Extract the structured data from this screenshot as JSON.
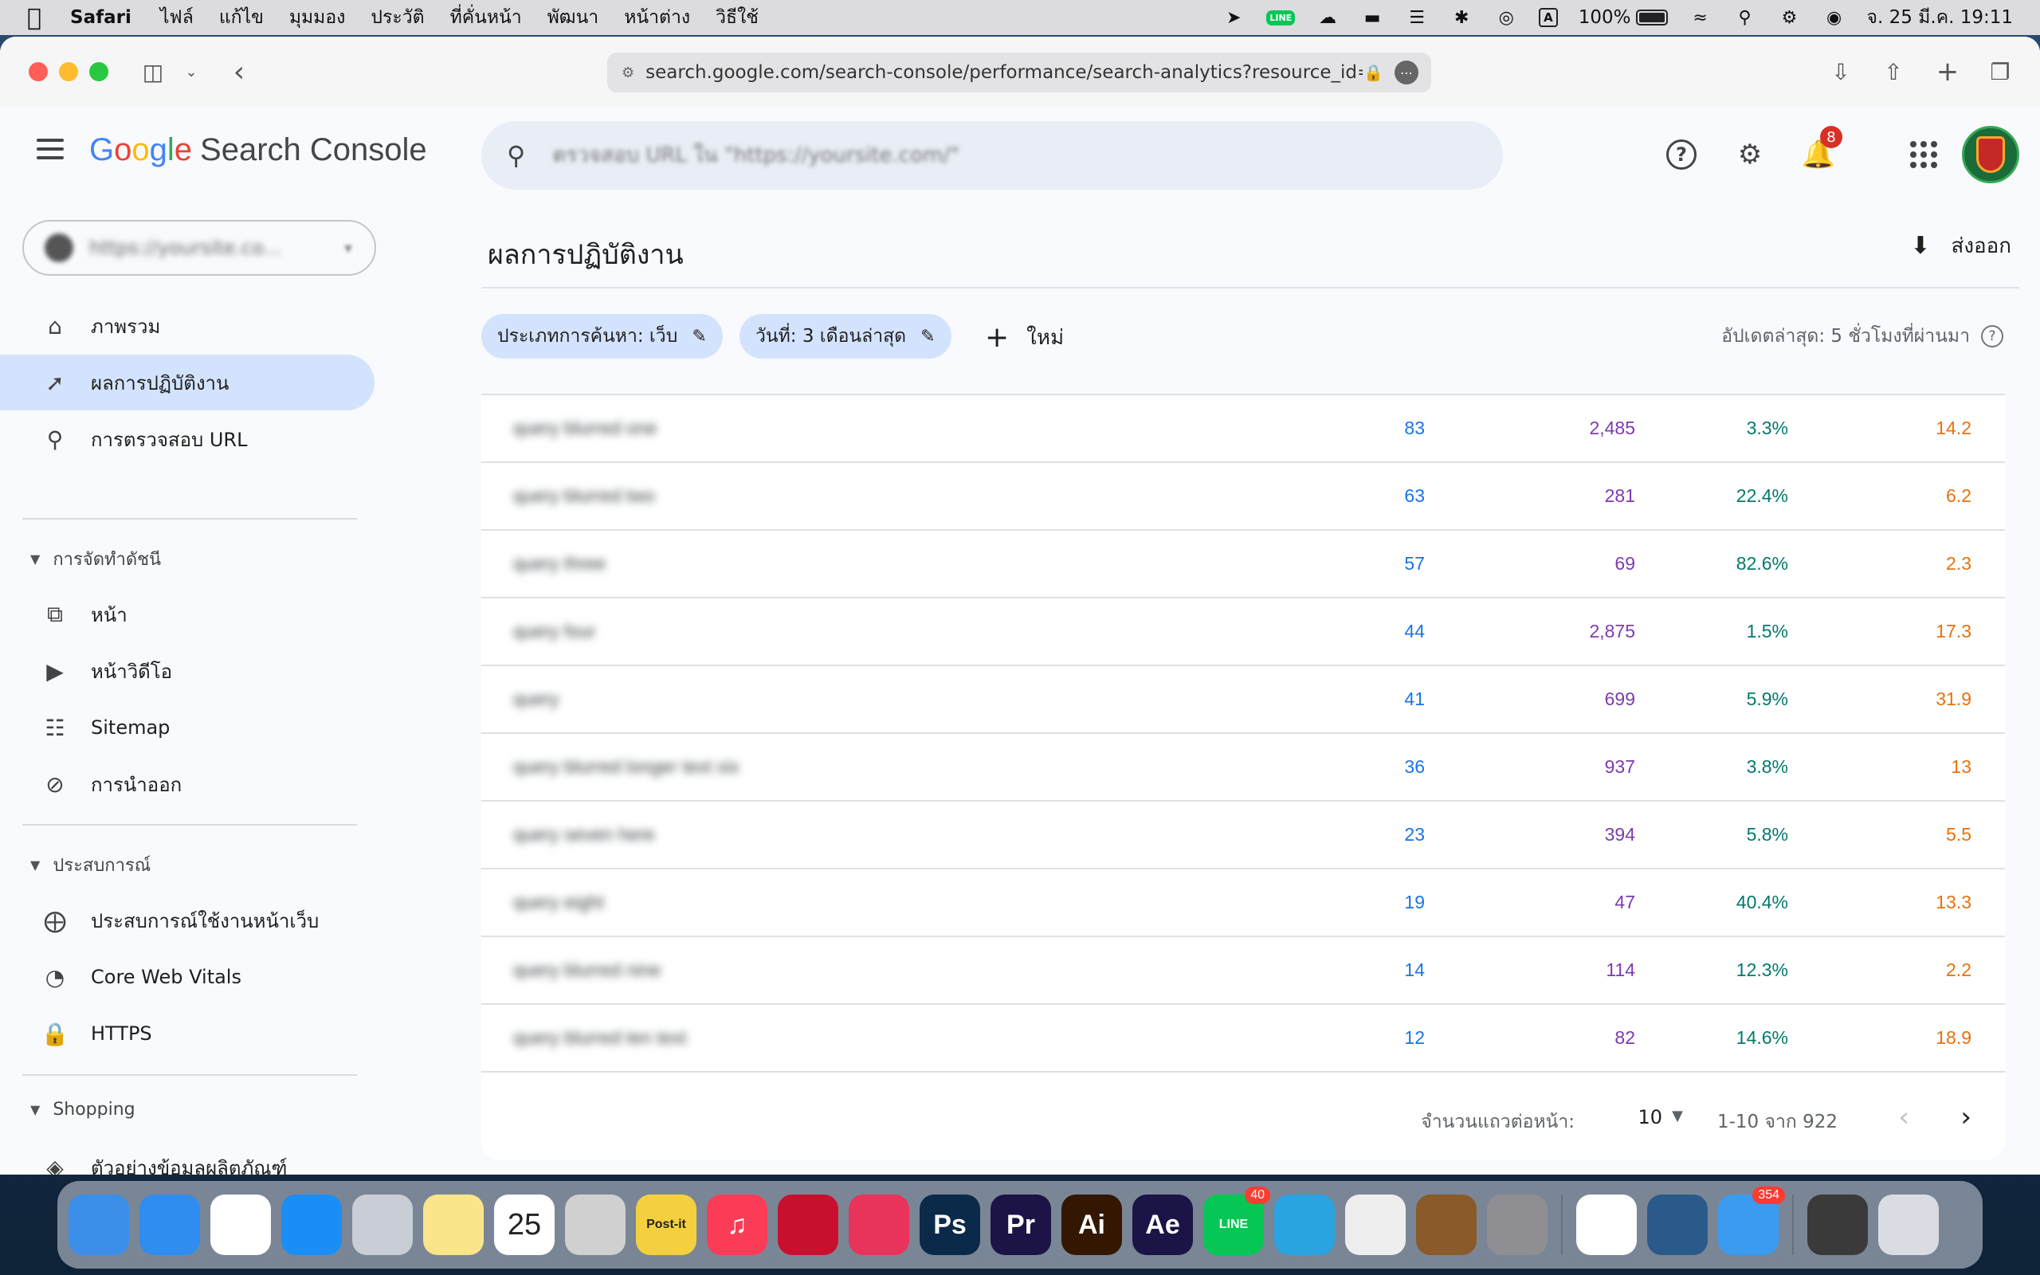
{
  "menubar": {
    "app_name": "Safari",
    "menus": [
      "ไฟล์",
      "แก้ไข",
      "มุมมอง",
      "ประวัติ",
      "ที่คั่นหน้า",
      "พัฒนา",
      "หน้าต่าง",
      "วิธีใช้"
    ],
    "battery": "100%",
    "input_source": "A",
    "clock": "จ. 25 มี.ค. 19:11"
  },
  "browser": {
    "url": "search.google.com/search-console/performance/search-analytics?resource_id=ht"
  },
  "header": {
    "logo_g": [
      "G",
      "o",
      "o",
      "g",
      "l",
      "e"
    ],
    "product": "Search Console",
    "search_placeholder": "ตรวจสอบ URL ใน \"https://yoursite.com/\"",
    "notification_count": "8"
  },
  "sidebar": {
    "property": "https://yoursite.co...",
    "items": [
      {
        "label": "ภาพรวม",
        "icon": "home-icon"
      },
      {
        "label": "ผลการปฏิบัติงาน",
        "icon": "trending-up-icon"
      },
      {
        "label": "การตรวจสอบ URL",
        "icon": "search-icon"
      }
    ],
    "section_index": {
      "title": "การจัดทำดัชนี",
      "items": [
        {
          "label": "หน้า",
          "icon": "pages-icon"
        },
        {
          "label": "หน้าวิดีโอ",
          "icon": "video-pages-icon"
        },
        {
          "label": "Sitemap",
          "icon": "sitemap-icon"
        },
        {
          "label": "การนำออก",
          "icon": "removals-icon"
        }
      ]
    },
    "section_experience": {
      "title": "ประสบการณ์",
      "items": [
        {
          "label": "ประสบการณ์ใช้งานหน้าเว็บ",
          "icon": "page-experience-icon"
        },
        {
          "label": "Core Web Vitals",
          "icon": "gauge-icon"
        },
        {
          "label": "HTTPS",
          "icon": "lock-icon"
        }
      ]
    },
    "section_shopping": {
      "title": "Shopping",
      "items": [
        {
          "label": "ตัวอย่างข้อมูลผลิตภัณฑ์",
          "icon": "layers-icon"
        }
      ]
    }
  },
  "main": {
    "title": "ผลการปฏิบัติงาน",
    "export_label": "ส่งออก",
    "chip_search_type": "ประเภทการค้นหา: เว็บ",
    "chip_date": "วันที่: 3 เดือนล่าสุด",
    "new_label": "ใหม่",
    "updated": "อัปเดตล่าสุด: 5 ชั่วโมงที่ผ่านมา",
    "rows": [
      {
        "query": "query blurred one",
        "clicks": "83",
        "impressions": "2,485",
        "ctr": "3.3%",
        "position": "14.2"
      },
      {
        "query": "query blurred two",
        "clicks": "63",
        "impressions": "281",
        "ctr": "22.4%",
        "position": "6.2"
      },
      {
        "query": "query three",
        "clicks": "57",
        "impressions": "69",
        "ctr": "82.6%",
        "position": "2.3"
      },
      {
        "query": "query four",
        "clicks": "44",
        "impressions": "2,875",
        "ctr": "1.5%",
        "position": "17.3"
      },
      {
        "query": "query",
        "clicks": "41",
        "impressions": "699",
        "ctr": "5.9%",
        "position": "31.9"
      },
      {
        "query": "query blurred longer text six",
        "clicks": "36",
        "impressions": "937",
        "ctr": "3.8%",
        "position": "13"
      },
      {
        "query": "query seven here",
        "clicks": "23",
        "impressions": "394",
        "ctr": "5.8%",
        "position": "5.5"
      },
      {
        "query": "query eight",
        "clicks": "19",
        "impressions": "47",
        "ctr": "40.4%",
        "position": "13.3"
      },
      {
        "query": "query blurred nine",
        "clicks": "14",
        "impressions": "114",
        "ctr": "12.3%",
        "position": "2.2"
      },
      {
        "query": "query blurred ten text",
        "clicks": "12",
        "impressions": "82",
        "ctr": "14.6%",
        "position": "18.9"
      }
    ],
    "pager": {
      "rows_per_page_label": "จำนวนแถวต่อหน้า:",
      "rows_per_page": "10",
      "range": "1-10 จาก 922"
    }
  },
  "dock": {
    "apps": [
      {
        "name": "finder-icon",
        "label": "",
        "bg": "#3b8fe8"
      },
      {
        "name": "safari-icon",
        "label": "",
        "bg": "#2f8df0"
      },
      {
        "name": "chrome-icon",
        "label": "",
        "bg": "#ffffff"
      },
      {
        "name": "app-store-icon",
        "label": "",
        "bg": "#1b8ef5"
      },
      {
        "name": "launchpad-icon",
        "label": "",
        "bg": "#c9cdd6"
      },
      {
        "name": "notes-icon",
        "label": "",
        "bg": "#fbe58a"
      },
      {
        "name": "calendar-icon",
        "label": "25",
        "bg": "#ffffff"
      },
      {
        "name": "screenshot-icon",
        "label": "",
        "bg": "#d0d0d0"
      },
      {
        "name": "post-it-icon",
        "label": "Post-it",
        "bg": "#f4d03f"
      },
      {
        "name": "music-icon",
        "label": "♫",
        "bg": "#fa3c56"
      },
      {
        "name": "acrobat-icon",
        "label": "",
        "bg": "#c8102e"
      },
      {
        "name": "creative-cloud-icon",
        "label": "",
        "bg": "#e8345a"
      },
      {
        "name": "photoshop-icon",
        "label": "Ps",
        "bg": "#0b2a4a"
      },
      {
        "name": "premiere-icon",
        "label": "Pr",
        "bg": "#1c1447"
      },
      {
        "name": "illustrator-icon",
        "label": "Ai",
        "bg": "#331700"
      },
      {
        "name": "after-effects-icon",
        "label": "Ae",
        "bg": "#1b1446"
      },
      {
        "name": "line-icon",
        "label": "LINE",
        "bg": "#06c755",
        "badge": "40"
      },
      {
        "name": "telegram-icon",
        "label": "",
        "bg": "#2aa3e1"
      },
      {
        "name": "podcast-icon",
        "label": "",
        "bg": "#eeeeee"
      },
      {
        "name": "photo-booth-icon",
        "label": "",
        "bg": "#8a5a2a"
      },
      {
        "name": "system-settings-icon",
        "label": "",
        "bg": "#8e8e93"
      },
      {
        "name": "photos-icon",
        "label": "",
        "bg": "#ffffff"
      },
      {
        "name": "quicktime-icon",
        "label": "",
        "bg": "#2a5a8a"
      },
      {
        "name": "mail-icon",
        "label": "",
        "bg": "#3a9bf0",
        "badge": "354"
      },
      {
        "name": "photoshop-file-icon",
        "label": "",
        "bg": "#3a3a3a"
      },
      {
        "name": "trash-icon",
        "label": "",
        "bg": "#d9dde3"
      }
    ],
    "accent_blue": "#1a73e8",
    "accent_purple": "#7e3ab0",
    "accent_teal": "#00796b",
    "accent_orange": "#e8710a"
  }
}
